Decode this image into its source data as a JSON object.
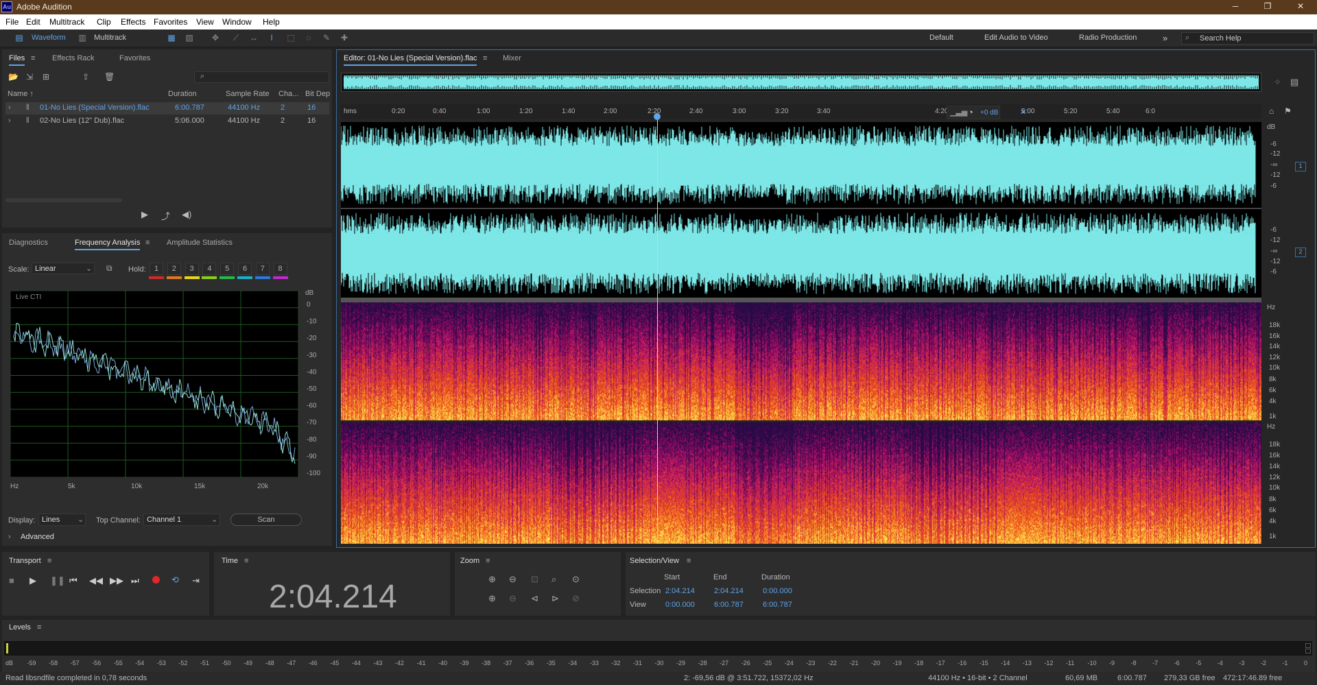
{
  "app": {
    "title": "Adobe Audition",
    "logo": "Au"
  },
  "window_controls": [
    "─",
    "❐",
    "✕"
  ],
  "menu": [
    "File",
    "Edit",
    "Multitrack",
    "Clip",
    "Effects",
    "Favorites",
    "View",
    "Window",
    "Help"
  ],
  "toolbar": {
    "waveform_label": "Waveform",
    "multitrack_label": "Multitrack",
    "workspaces": [
      "Default",
      "Edit Audio to Video",
      "Radio Production"
    ],
    "more_label": "»",
    "search_placeholder": "Search Help"
  },
  "files_panel": {
    "tabs": [
      "Files",
      "Effects Rack",
      "Favorites"
    ],
    "search_placeholder": "",
    "columns": [
      "Name ↑",
      "Duration",
      "Sample Rate",
      "Cha...",
      "Bit Dep"
    ],
    "rows": [
      {
        "name": "01-No Lies (Special Version).flac",
        "duration": "6:00.787",
        "rate": "44100 Hz",
        "ch": "2",
        "bits": "16",
        "selected": true
      },
      {
        "name": "02-No Lies (12\" Dub).flac",
        "duration": "5:06.000",
        "rate": "44100 Hz",
        "ch": "2",
        "bits": "16",
        "selected": false
      }
    ]
  },
  "analysis_panel": {
    "tabs": [
      "Diagnostics",
      "Frequency Analysis",
      "Amplitude Statistics"
    ],
    "scale_label": "Scale:",
    "scale_value": "Linear",
    "hold_label": "Hold:",
    "hold_buttons": [
      "1",
      "2",
      "3",
      "4",
      "5",
      "6",
      "7",
      "8"
    ],
    "hold_colors": [
      "#d12a2a",
      "#e07a1a",
      "#e8d81a",
      "#8ad01a",
      "#26b84a",
      "#1ab0c8",
      "#2a7ae0",
      "#c02ad0"
    ],
    "graph_label": "Live CTI",
    "db_unit": "dB",
    "db_ticks": [
      "0",
      "-10",
      "-20",
      "-30",
      "-40",
      "-50",
      "-60",
      "-70",
      "-80",
      "-90",
      "-100"
    ],
    "hz_ticks": [
      "Hz",
      "5k",
      "10k",
      "15k",
      "20k"
    ],
    "display_label": "Display:",
    "display_value": "Lines",
    "top_channel_label": "Top Channel:",
    "top_channel_value": "Channel 1",
    "scan_label": "Scan",
    "advanced_label": "Advanced"
  },
  "editor": {
    "tabs": [
      "Editor: 01-No Lies (Special Version).flac",
      "Mixer"
    ],
    "ruler_unit": "hms",
    "ruler_ticks": [
      "0:20",
      "0:40",
      "1:00",
      "1:20",
      "1:40",
      "2:00",
      "2:20",
      "2:40",
      "3:00",
      "3:20",
      "3:40",
      "4:20",
      "4:40",
      "5:00",
      "5:20",
      "5:40",
      "6:0"
    ],
    "gain_label": "+0 dB",
    "amp_ticks": [
      "dB",
      "-6",
      "-12",
      "-∞",
      "-12",
      "-6"
    ],
    "amp_ticks_ch2": [
      "-6",
      "-12",
      "-∞",
      "-12",
      "-6"
    ],
    "channel_badges": [
      "1",
      "2"
    ],
    "freq_ticks": [
      "Hz",
      "18k",
      "16k",
      "14k",
      "12k",
      "10k",
      "8k",
      "6k",
      "4k",
      "1k"
    ],
    "waveform_color": "#7de6e6",
    "playhead_position_seconds": 124.214
  },
  "transport": {
    "title": "Transport"
  },
  "time_panel": {
    "title": "Time",
    "value": "2:04.214"
  },
  "zoom_panel": {
    "title": "Zoom"
  },
  "selection_panel": {
    "title": "Selection/View",
    "headers": [
      "Start",
      "End",
      "Duration"
    ],
    "selection_label": "Selection",
    "view_label": "View",
    "selection": [
      "2:04.214",
      "2:04.214",
      "0:00.000"
    ],
    "view": [
      "0:00.000",
      "6:00.787",
      "6:00.787"
    ]
  },
  "levels": {
    "title": "Levels",
    "ticks": [
      "dB",
      "-59",
      "-58",
      "-57",
      "-56",
      "-55",
      "-54",
      "-53",
      "-52",
      "-51",
      "-50",
      "-49",
      "-48",
      "-47",
      "-46",
      "-45",
      "-44",
      "-43",
      "-42",
      "-41",
      "-40",
      "-39",
      "-38",
      "-37",
      "-36",
      "-35",
      "-34",
      "-33",
      "-32",
      "-31",
      "-30",
      "-29",
      "-28",
      "-27",
      "-26",
      "-25",
      "-24",
      "-23",
      "-22",
      "-21",
      "-20",
      "-19",
      "-18",
      "-17",
      "-16",
      "-15",
      "-14",
      "-13",
      "-12",
      "-11",
      "-10",
      "-9",
      "-8",
      "-7",
      "-6",
      "-5",
      "-4",
      "-3",
      "-2",
      "-1",
      "0"
    ]
  },
  "status": {
    "message": "Read libsndfile completed in 0,78 seconds",
    "cursor_info": "2: -69,56 dB @ 3:51.722, 15372,02 Hz",
    "format": "44100 Hz • 16-bit • 2 Channel",
    "size": "60,69 MB",
    "duration": "6:00.787",
    "free": "279,33 GB free",
    "free_time": "472:17:46.89 free"
  }
}
